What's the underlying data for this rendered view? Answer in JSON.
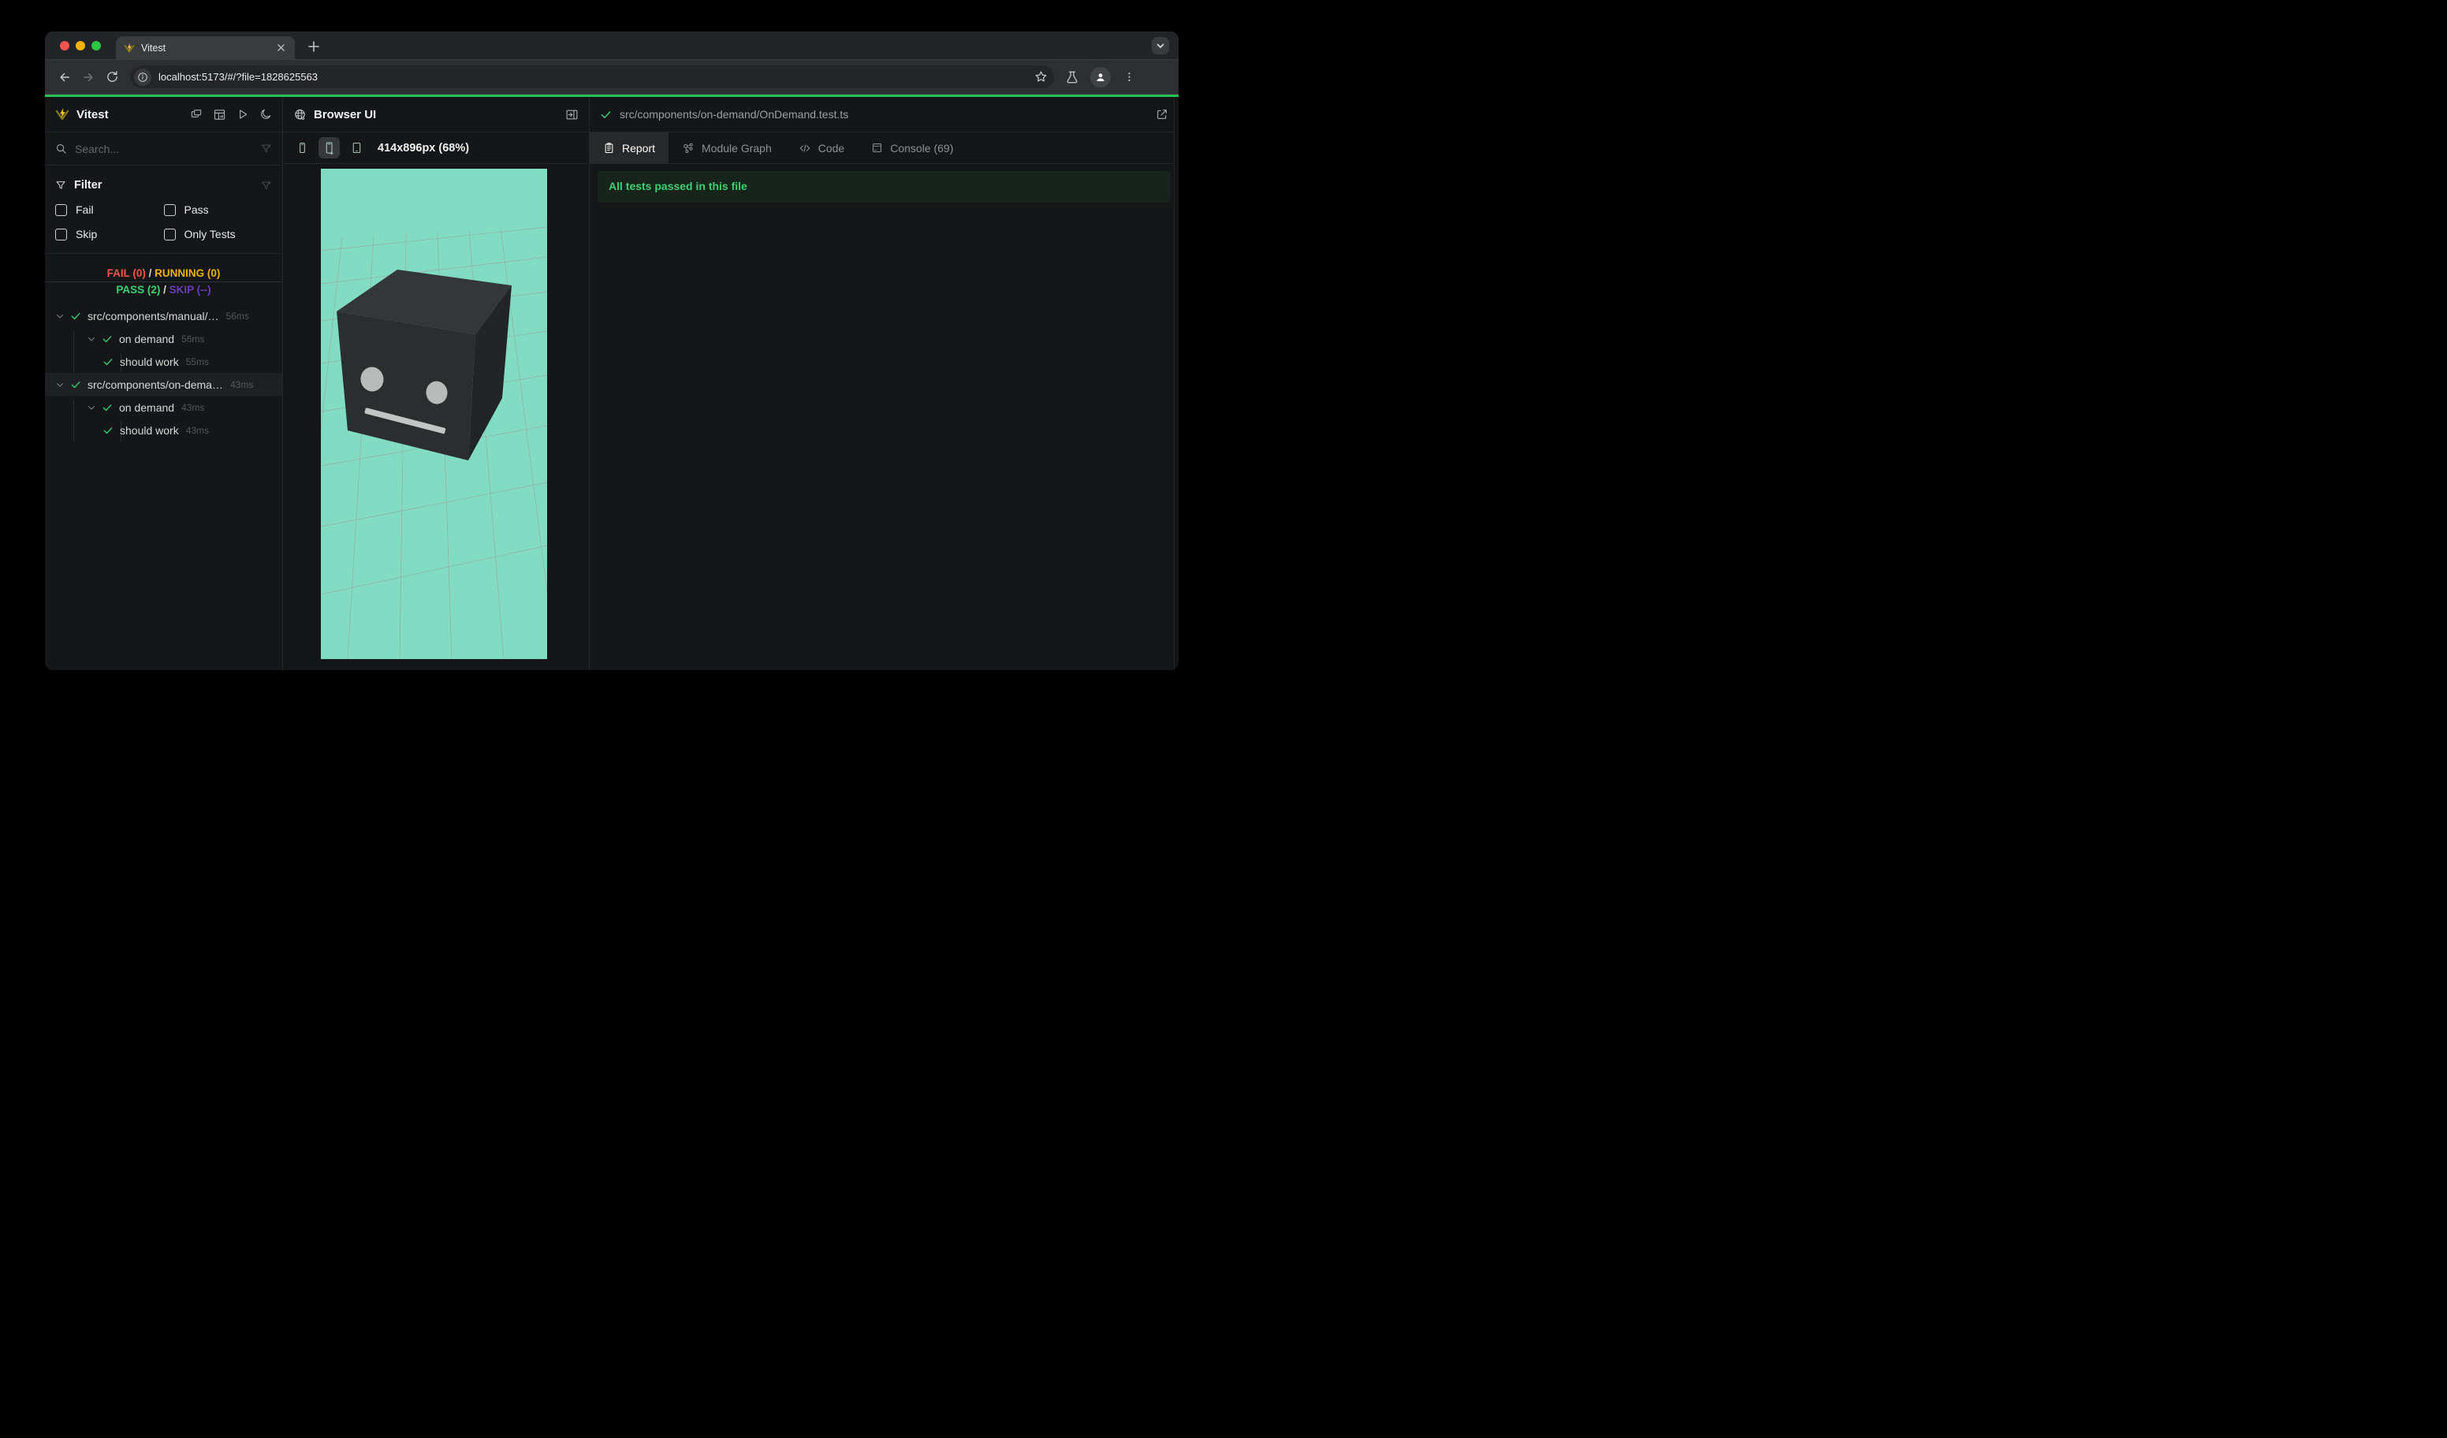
{
  "window": {
    "tab_title": "Vitest",
    "new_tab_glyph": "+",
    "close_glyph": "✕"
  },
  "toolbar": {
    "url": "localhost:5173/#/?file=1828625563"
  },
  "sidebar": {
    "app_title": "Vitest",
    "search_placeholder": "Search...",
    "filter": {
      "title": "Filter",
      "options": [
        "Fail",
        "Pass",
        "Skip",
        "Only Tests"
      ]
    },
    "summary": {
      "fail": "FAIL (0)",
      "running": "RUNNING (0)",
      "pass": "PASS (2)",
      "skip": "SKIP (--)",
      "separator": "/"
    },
    "tree": [
      {
        "label": "src/components/manual/…",
        "time": "56ms",
        "type": "file",
        "status": "pass",
        "selected": false
      },
      {
        "label": "on demand",
        "time": "56ms",
        "type": "suite",
        "status": "pass"
      },
      {
        "label": "should work",
        "time": "55ms",
        "type": "test",
        "status": "pass"
      },
      {
        "label": "src/components/on-dema…",
        "time": "43ms",
        "type": "file",
        "status": "pass",
        "selected": true
      },
      {
        "label": "on demand",
        "time": "43ms",
        "type": "suite",
        "status": "pass"
      },
      {
        "label": "should work",
        "time": "43ms",
        "type": "test",
        "status": "pass"
      }
    ]
  },
  "browser_panel": {
    "title": "Browser UI",
    "viewport_label": "414x896px (68%)",
    "preview_background": "#82dcc4"
  },
  "report_panel": {
    "file_path": "src/components/on-demand/OnDemand.test.ts",
    "tabs": [
      {
        "label": "Report",
        "active": true
      },
      {
        "label": "Module Graph",
        "active": false
      },
      {
        "label": "Code",
        "active": false
      },
      {
        "label": "Console (69)",
        "active": false
      }
    ],
    "banner_text": "All tests passed in this file"
  },
  "colors": {
    "accent_green_bar": "#2abf55",
    "pass_green": "#35c96f",
    "fail_red": "#f2544c",
    "running_yellow": "#eab10d",
    "skip_purple": "#6a3db8",
    "preview_teal": "#82dcc4",
    "banner_bg": "#16241c"
  },
  "icons": {
    "traffic_lights": [
      "close-red",
      "minimize-yellow",
      "zoom-green"
    ],
    "named": [
      "vitest-logo",
      "search-icon",
      "funnel-icon",
      "clear-filter-icon",
      "copy-windows-icon",
      "dashboard-icon",
      "run-all-icon",
      "dark-mode-moon-icon",
      "globe-icon",
      "panel-open-icon",
      "device-phone-icon",
      "device-phone-plus-icon",
      "device-tablet-icon",
      "report-clipboard-icon",
      "module-graph-icon",
      "code-icon",
      "console-icon",
      "external-link-icon",
      "star-icon",
      "flask-icon",
      "avatar-icon",
      "kebab-menu-icon",
      "info-icon",
      "back-icon",
      "forward-icon",
      "reload-icon"
    ]
  }
}
